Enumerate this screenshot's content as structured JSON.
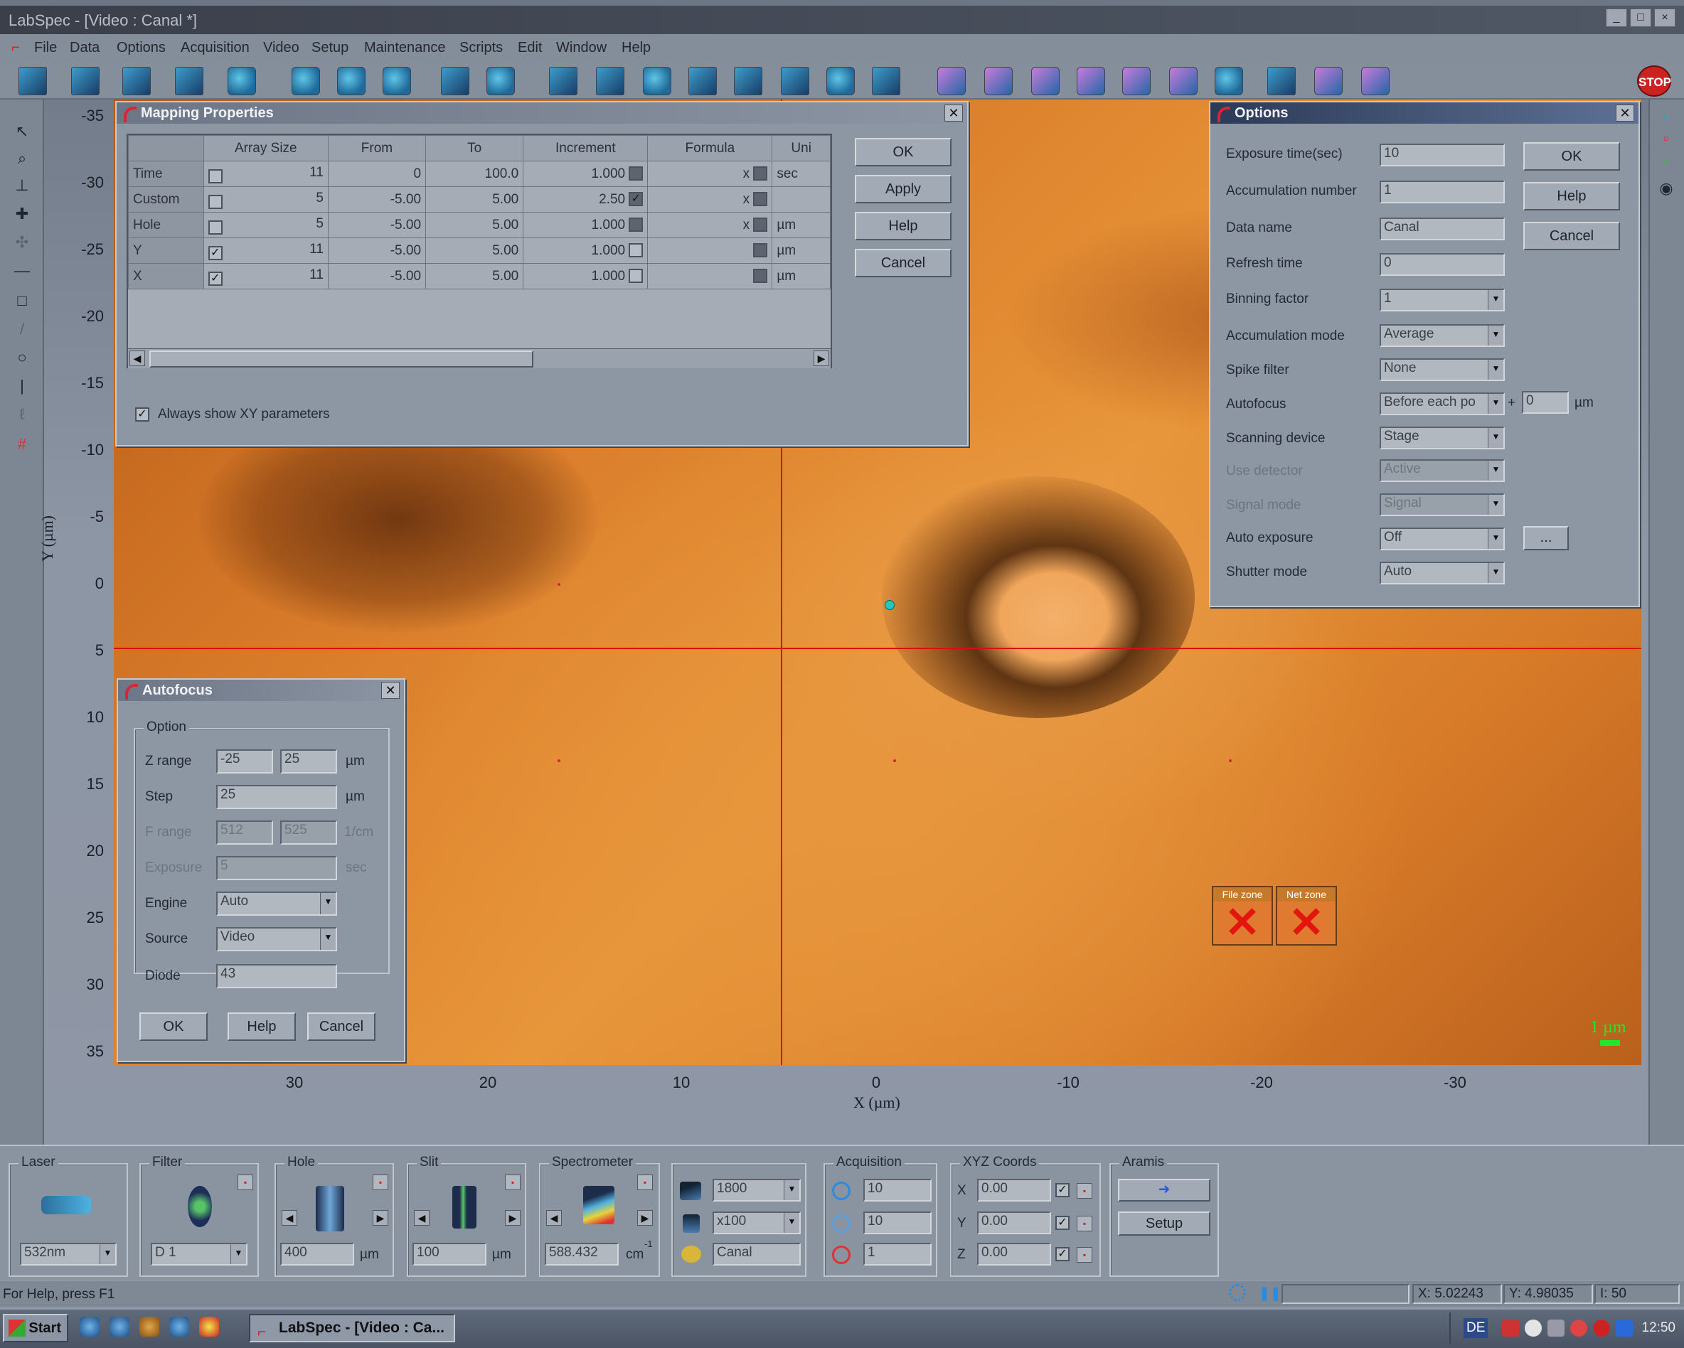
{
  "app": {
    "title": "LabSpec - [Video : Canal *]"
  },
  "menu": [
    "File",
    "Data",
    "Options",
    "Acquisition",
    "Video",
    "Setup",
    "Maintenance",
    "Scripts",
    "Edit",
    "Window",
    "Help"
  ],
  "toolbar": {
    "stop_label": "STOP"
  },
  "axes": {
    "y_ticks": [
      "-35",
      "-30",
      "-25",
      "-20",
      "-15",
      "-10",
      "-5",
      "0",
      "5",
      "10",
      "15",
      "20",
      "25",
      "30",
      "35"
    ],
    "y_label": "Y (µm)",
    "x_ticks": [
      "30",
      "20",
      "10",
      "0",
      "-10",
      "-20",
      "-30"
    ],
    "x_label": "X (µm)"
  },
  "video": {
    "scale_label": "1 µm",
    "file_zone": "File zone",
    "net_zone": "Net zone"
  },
  "mapping": {
    "title": "Mapping Properties",
    "columns": [
      "Array Size",
      "From",
      "To",
      "Increment",
      "Formula",
      "Uni"
    ],
    "rows": [
      {
        "name": "Time",
        "checked": false,
        "size": "11",
        "from": "0",
        "to": "100.0",
        "inc": "1.000",
        "inc_chk": "fill",
        "formula": "x",
        "unit": "sec"
      },
      {
        "name": "Custom",
        "checked": false,
        "size": "5",
        "from": "-5.00",
        "to": "5.00",
        "inc": "2.50",
        "inc_chk": "checked",
        "formula": "x",
        "unit": ""
      },
      {
        "name": "Hole",
        "checked": false,
        "size": "5",
        "from": "-5.00",
        "to": "5.00",
        "inc": "1.000",
        "inc_chk": "fill",
        "formula": "x",
        "unit": "µm"
      },
      {
        "name": "Y",
        "checked": true,
        "size": "11",
        "from": "-5.00",
        "to": "5.00",
        "inc": "1.000",
        "inc_chk": "empty",
        "formula": "",
        "unit": "µm"
      },
      {
        "name": "X",
        "checked": true,
        "size": "11",
        "from": "-5.00",
        "to": "5.00",
        "inc": "1.000",
        "inc_chk": "empty",
        "formula": "",
        "unit": "µm"
      }
    ],
    "always_show": "Always show XY parameters",
    "ok": "OK",
    "apply": "Apply",
    "help": "Help",
    "cancel": "Cancel"
  },
  "options": {
    "title": "Options",
    "fields": [
      {
        "label": "Exposure time(sec)",
        "value": "10",
        "type": "text"
      },
      {
        "label": "Accumulation number",
        "value": "1",
        "type": "text"
      },
      {
        "label": "Data name",
        "value": "Canal",
        "type": "text"
      },
      {
        "label": "Refresh time",
        "value": "0",
        "type": "text"
      },
      {
        "label": "Binning factor",
        "value": "1",
        "type": "select"
      },
      {
        "label": "Accumulation mode",
        "value": "Average",
        "type": "select"
      },
      {
        "label": "Spike filter",
        "value": "None",
        "type": "select"
      },
      {
        "label": "Autofocus",
        "value": "Before each po",
        "type": "select"
      },
      {
        "label": "Scanning device",
        "value": "Stage",
        "type": "select"
      },
      {
        "label": "Use detector",
        "value": "Active",
        "type": "select",
        "disabled": true
      },
      {
        "label": "Signal mode",
        "value": "Signal",
        "type": "select",
        "disabled": true
      },
      {
        "label": "Auto exposure",
        "value": "Off",
        "type": "select"
      },
      {
        "label": "Shutter mode",
        "value": "Auto",
        "type": "select"
      }
    ],
    "autofocus_plus": "+",
    "autofocus_offset": "0",
    "autofocus_unit": "µm",
    "ellipsis": "...",
    "ok": "OK",
    "help": "Help",
    "cancel": "Cancel"
  },
  "autofocus": {
    "title": "Autofocus",
    "group": "Option",
    "z_label": "Z range",
    "z_min": "-25",
    "z_max": "25",
    "z_unit": "µm",
    "step_label": "Step",
    "step": "25",
    "step_unit": "µm",
    "frange_label": "F range",
    "f_min": "512",
    "f_max": "525",
    "f_unit": "1/cm",
    "exposure_label": "Exposure",
    "exposure": "5",
    "exposure_unit": "sec",
    "engine_label": "Engine",
    "engine": "Auto",
    "source_label": "Source",
    "source": "Video",
    "diode_label": "Diode",
    "diode": "43",
    "ok": "OK",
    "help": "Help",
    "cancel": "Cancel"
  },
  "panel": {
    "laser": {
      "label": "Laser",
      "value": "532nm"
    },
    "filter": {
      "label": "Filter",
      "value": "D 1"
    },
    "hole": {
      "label": "Hole",
      "value": "400",
      "unit": "µm"
    },
    "slit": {
      "label": "Slit",
      "value": "100",
      "unit": "µm"
    },
    "spectrometer": {
      "label": "Spectrometer",
      "value": "588.432",
      "unit": "cm",
      "sup": "-1"
    },
    "grating": "1800",
    "objective": "x100",
    "dataname": "Canal",
    "acquisition": {
      "label": "Acquisition",
      "v1": "10",
      "v2": "10",
      "v3": "1"
    },
    "xyz": {
      "label": "XYZ Coords",
      "x_label": "X",
      "x": "0.00",
      "y_label": "Y",
      "y": "0.00",
      "z_label": "Z",
      "z": "0.00"
    },
    "aramis": {
      "label": "Aramis",
      "setup": "Setup"
    }
  },
  "status": {
    "help": "For Help, press F1",
    "x": "X: 5.02243",
    "y": "Y: 4.98035",
    "i": "I: 50"
  },
  "taskbar": {
    "start": "Start",
    "task": "LabSpec - [Video : Ca...",
    "lang": "DE",
    "time": "12:50"
  },
  "colors": {
    "crosshair": "#d81010",
    "video": "#e0872f",
    "scale": "#1fea2a"
  }
}
